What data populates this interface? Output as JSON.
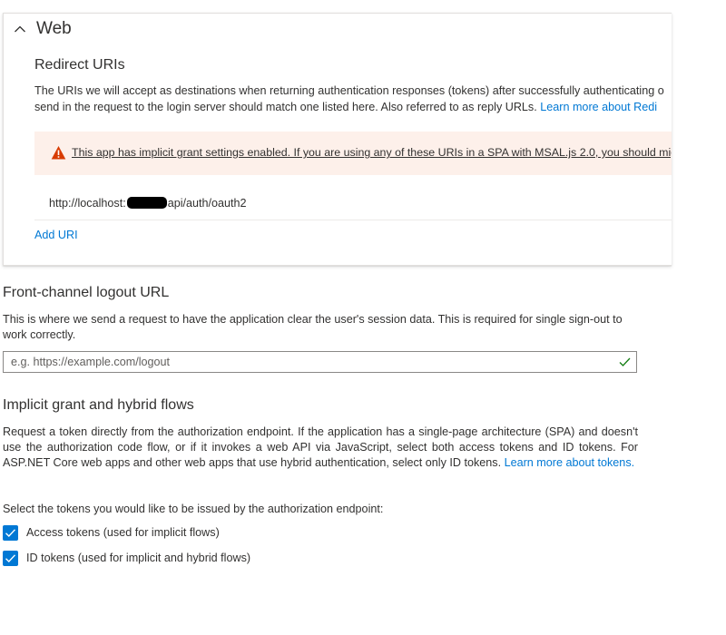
{
  "web_section": {
    "title": "Web",
    "redirect_uris_title": "Redirect URIs",
    "description_line1": "The URIs we will accept as destinations when returning authentication responses (tokens) after successfully authenticating o",
    "description_line2": "send in the request to the login server should match one listed here. Also referred to as reply URLs.",
    "learn_more": "Learn more about Redi",
    "warning_text": "This app has implicit grant settings enabled. If you are using any of these URIs in a SPA with MSAL.js 2.0, you should migrate U",
    "uri_prefix": "http://localhost:",
    "uri_suffix": "api/auth/oauth2",
    "add_uri": "Add URI"
  },
  "logout_section": {
    "title": "Front-channel logout URL",
    "description": "This is where we send a request to have the application clear the user's session data. This is required for single sign-out to work correctly.",
    "input_placeholder": "e.g. https://example.com/logout",
    "input_value": ""
  },
  "implicit_section": {
    "title": "Implicit grant and hybrid flows",
    "description": "Request a token directly from the authorization endpoint. If the application has a single-page architecture (SPA) and doesn't use the authorization code flow, or if it invokes a web API via JavaScript, select both access tokens and ID tokens. For ASP.NET Core web apps and other web apps that use hybrid authentication, select only ID tokens.",
    "learn_more": "Learn more about tokens.",
    "select_prompt": "Select the tokens you would like to be issued by the authorization endpoint:",
    "options": [
      {
        "label": "Access tokens (used for implicit flows)",
        "checked": true
      },
      {
        "label": "ID tokens (used for implicit and hybrid flows)",
        "checked": true
      }
    ]
  },
  "colors": {
    "accent": "#0078d4",
    "warning_bg": "#fdf0ea",
    "warning_icon": "#d83b01",
    "valid_check": "#107c10"
  },
  "icons": {
    "collapse": "chevron-up-icon",
    "warning": "warning-icon",
    "valid": "checkmark-icon",
    "checkbox": "checkbox-checked-icon"
  }
}
